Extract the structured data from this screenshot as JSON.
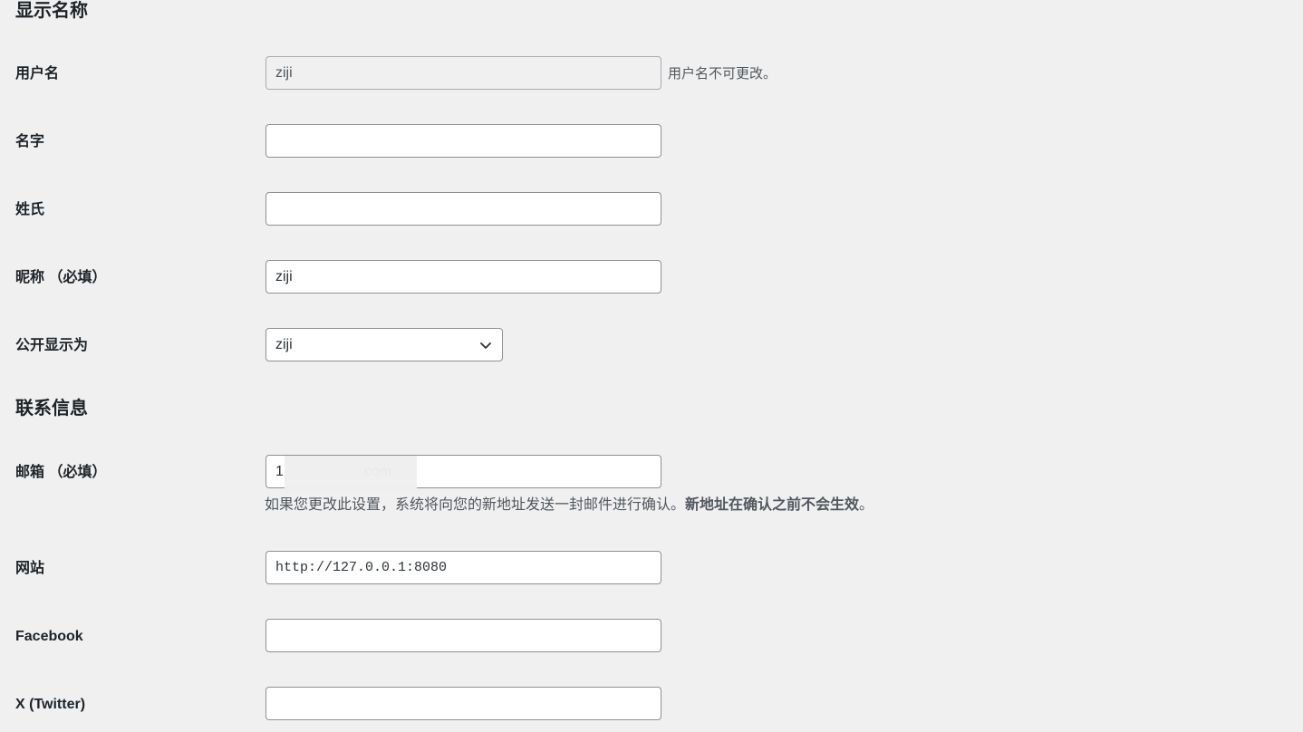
{
  "sections": {
    "name_title": "显示名称",
    "contact_title": "联系信息"
  },
  "fields": {
    "username": {
      "label": "用户名",
      "value": "ziji",
      "note": "用户名不可更改。"
    },
    "first_name": {
      "label": "名字",
      "value": ""
    },
    "last_name": {
      "label": "姓氏",
      "value": ""
    },
    "nickname": {
      "label": "昵称 （必填）",
      "value": "ziji"
    },
    "display_name": {
      "label": "公开显示为",
      "selected": "ziji"
    },
    "email": {
      "label": "邮箱 （必填）",
      "value": "1                    com",
      "desc_normal": "如果您更改此设置，系统将向您的新地址发送一封邮件进行确认。",
      "desc_bold": "新地址在确认之前不会生效",
      "desc_end": "。"
    },
    "website": {
      "label": "网站",
      "value": "http://127.0.0.1:8080"
    },
    "facebook": {
      "label": "Facebook",
      "value": ""
    },
    "twitter": {
      "label": "X (Twitter)",
      "value": ""
    }
  },
  "icons": {
    "select_arrow": "chevron-down-icon"
  }
}
